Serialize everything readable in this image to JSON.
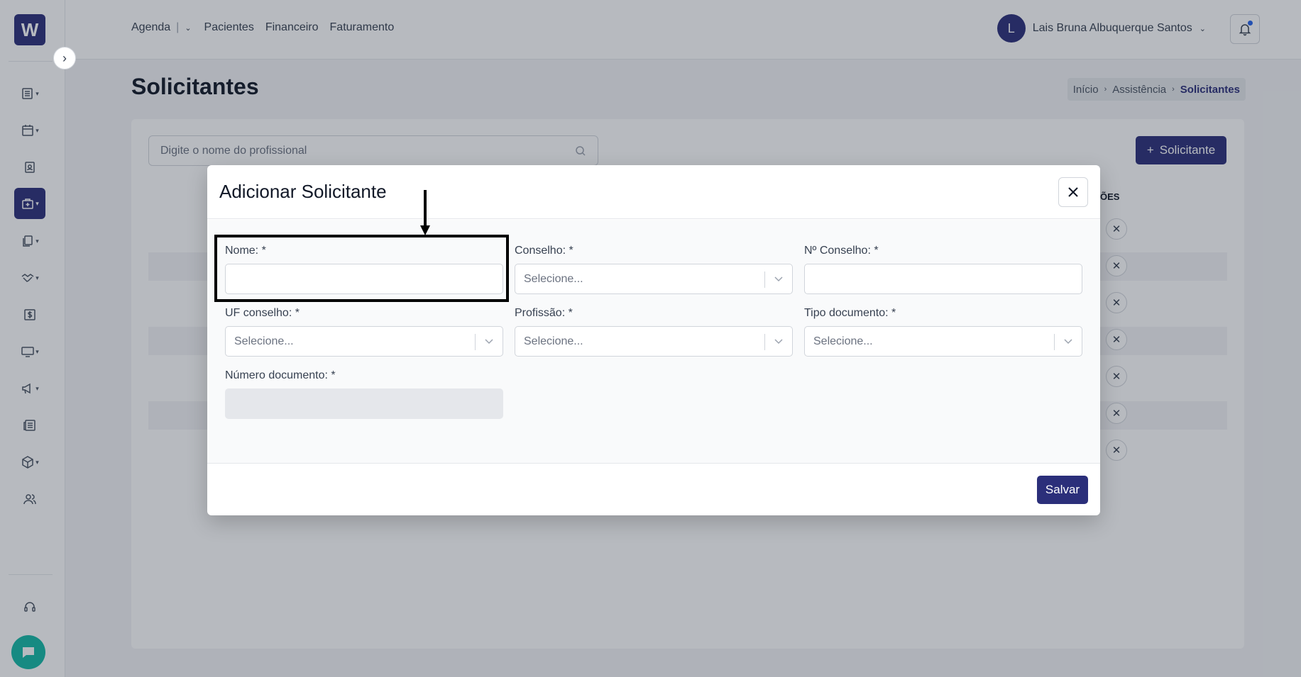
{
  "topbar": {
    "nav": [
      "Agenda",
      "Pacientes",
      "Financeiro",
      "Faturamento"
    ],
    "user_initial": "L",
    "user_name": "Lais Bruna Albuquerque Santos"
  },
  "sidebar": {
    "logo": "W",
    "items": [
      "list-icon",
      "calendar-icon",
      "contact-icon",
      "medical-bag-icon",
      "documents-icon",
      "handshake-icon",
      "dollar-icon",
      "monitor-icon",
      "megaphone-icon",
      "newspaper-icon",
      "box-icon",
      "users-icon",
      "headset-icon"
    ],
    "active_item": "medical-bag-icon"
  },
  "page": {
    "title": "Solicitantes",
    "breadcrumb": [
      "Início",
      "Assistência",
      "Solicitantes"
    ],
    "search_placeholder": "Digite o nome do profissional",
    "add_button": "Solicitante",
    "actions_header": "ÕES"
  },
  "modal": {
    "title": "Adicionar Solicitante",
    "fields": {
      "nome": {
        "label": "Nome: *",
        "value": ""
      },
      "conselho": {
        "label": "Conselho: *",
        "placeholder": "Selecione..."
      },
      "n_conselho": {
        "label": "Nº Conselho: *",
        "value": ""
      },
      "uf_conselho": {
        "label": "UF conselho: *",
        "placeholder": "Selecione..."
      },
      "profissao": {
        "label": "Profissão: *",
        "placeholder": "Selecione..."
      },
      "tipo_documento": {
        "label": "Tipo documento: *",
        "placeholder": "Selecione..."
      },
      "numero_documento": {
        "label": "Número documento: *",
        "value": ""
      }
    },
    "save_button": "Salvar"
  },
  "colors": {
    "primary": "#2b2f7a",
    "chat": "#14b8a6",
    "notification_dot": "#2563eb"
  }
}
